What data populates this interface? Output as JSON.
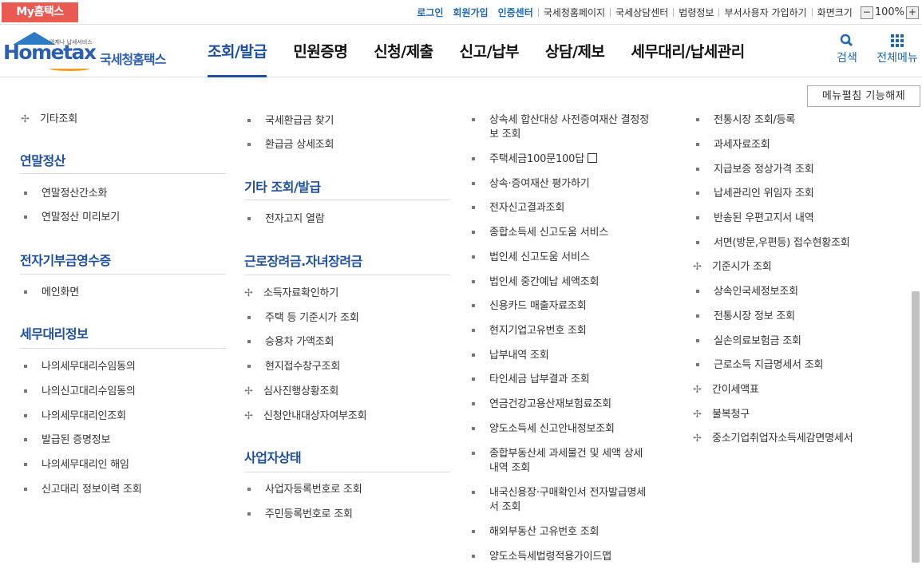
{
  "topbar": {
    "myhome": "My홈택스",
    "links_blue": [
      "로그인",
      "회원가입",
      "인증센터"
    ],
    "links": [
      "국세청홈페이지",
      "국세상담센터",
      "법령정보",
      "부서사용자 가입하기",
      "화면크기"
    ],
    "zoom_minus": "−",
    "zoom_value": "100%",
    "zoom_plus": "+"
  },
  "header": {
    "logo_text": "Hometax",
    "logo_sub": "언제나 납세서비스",
    "logo_kr": "국세청홈택스",
    "nav": [
      "조회/발급",
      "민원증명",
      "신청/제출",
      "신고/납부",
      "상담/제보",
      "세무대리/납세관리"
    ],
    "search_label": "검색",
    "allmenu_label": "전체메뉴"
  },
  "collapse_button": "메뉴펼침 기능해제",
  "col1": {
    "top_item": "기타조회",
    "sections": [
      {
        "title": "연말정산",
        "items": [
          "연말정산간소화",
          "연말정산 미리보기"
        ]
      },
      {
        "title": "전자기부금영수증",
        "items": [
          "메인화면"
        ]
      },
      {
        "title": "세무대리정보",
        "items": [
          "나의세무대리수임동의",
          "나의신고대리수임동의",
          "나의세무대리인조회",
          "발급된 증명정보",
          "나의세무대리인 해임",
          "신고대리 정보이력 조회"
        ]
      }
    ]
  },
  "col2": {
    "top_items": [
      "국세환급금 찾기",
      "환급금 상세조회"
    ],
    "sections": [
      {
        "title": "기타 조회/발급",
        "items": [
          "전자고지 열람"
        ]
      },
      {
        "title": "근로장려금.자녀장려금",
        "items": [
          "소득자료확인하기",
          "주택 등 기준시가 조회",
          "승용차 가액조회",
          "현지접수창구조회",
          "심사진행상황조회",
          "신청안내대상자여부조회"
        ]
      },
      {
        "title": "사업자상태",
        "items": [
          "사업자등록번호로 조회",
          "주민등록번호로 조회"
        ]
      }
    ]
  },
  "col3": {
    "items": [
      "상속세 합산대상 사전증여재산 결정정",
      "보 조회",
      "주택세금100문100답",
      "상속·증여재산 평가하기",
      "전자신고결과조회",
      "종합소득세 신고도움 서비스",
      "법인세 신고도움 서비스",
      "법인세 중간예납 세액조회",
      "신용카드 매출자료조회",
      "현지기업고유번호 조회",
      "납부내역 조회",
      "타인세금 납부결과 조회",
      "연금건강고용산재보험료조회",
      "양도소득세 신고안내정보조회",
      "종합부동산세 과세물건 및 세액 상세",
      "내역 조회",
      "내국신용장·구매확인서 전자발급명세",
      "서 조회",
      "해외부동산 고유번호 조회",
      "양도소득세법령적용가이드맵"
    ]
  },
  "col4": {
    "items": [
      "전통시장 조회/등록",
      "과세자료조회",
      "지급보증 정상가격 조회",
      "납세관리인 위임자 조회",
      "반송된 우편고지서 내역",
      "서면(방문,우편등) 접수현황조회",
      "기준시가 조회",
      "상속인국세정보조회",
      "전통시장 정보 조회",
      "실손의료보험금 조회",
      "근로소득 지급명세서 조회",
      "간이세액표",
      "불복청구",
      "중소기업취업자소득세감면명세서"
    ]
  }
}
